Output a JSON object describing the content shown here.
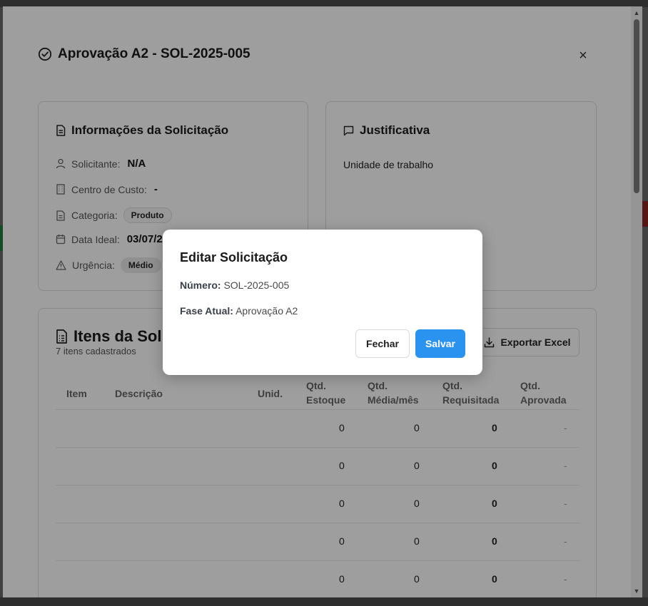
{
  "dialog": {
    "title": "Aprovação A2 - SOL-2025-005",
    "close_label": "×"
  },
  "info_card": {
    "title": "Informações da Solicitação",
    "solicitante_label": "Solicitante:",
    "solicitante_value": "N/A",
    "centro_label": "Centro de Custo:",
    "centro_value": "-",
    "categoria_label": "Categoria:",
    "categoria_value": "Produto",
    "data_label": "Data Ideal:",
    "data_value": "03/07/2",
    "urgencia_label": "Urgência:",
    "urgencia_value": "Médio"
  },
  "just_card": {
    "title": "Justificativa",
    "text": "Unidade de trabalho"
  },
  "items_card": {
    "title": "Itens da Soli",
    "subtitle": "7 itens cadastrados",
    "export_label": "Exportar Excel",
    "columns": {
      "item": "Item",
      "descricao": "Descrição",
      "unid": "Unid.",
      "estoque_1": "Qtd.",
      "estoque_2": "Estoque",
      "media_1": "Qtd.",
      "media_2": "Média/mês",
      "requisitada_1": "Qtd.",
      "requisitada_2": "Requisitada",
      "aprovada_1": "Qtd.",
      "aprovada_2": "Aprovada"
    },
    "rows": [
      {
        "estoque": "0",
        "media": "0",
        "requisitada": "0",
        "aprovada": "-"
      },
      {
        "estoque": "0",
        "media": "0",
        "requisitada": "0",
        "aprovada": "-"
      },
      {
        "estoque": "0",
        "media": "0",
        "requisitada": "0",
        "aprovada": "-"
      },
      {
        "estoque": "0",
        "media": "0",
        "requisitada": "0",
        "aprovada": "-"
      },
      {
        "estoque": "0",
        "media": "0",
        "requisitada": "0",
        "aprovada": "-"
      }
    ]
  },
  "modal": {
    "title": "Editar Solicitação",
    "numero_label": "Número:",
    "numero_value": "SOL-2025-005",
    "fase_label": "Fase Atual:",
    "fase_value": "Aprovação A2",
    "close_label": "Fechar",
    "save_label": "Salvar"
  },
  "colors": {
    "primary": "#2a93f0",
    "overlay": "rgba(0,0,0,0.38)"
  }
}
